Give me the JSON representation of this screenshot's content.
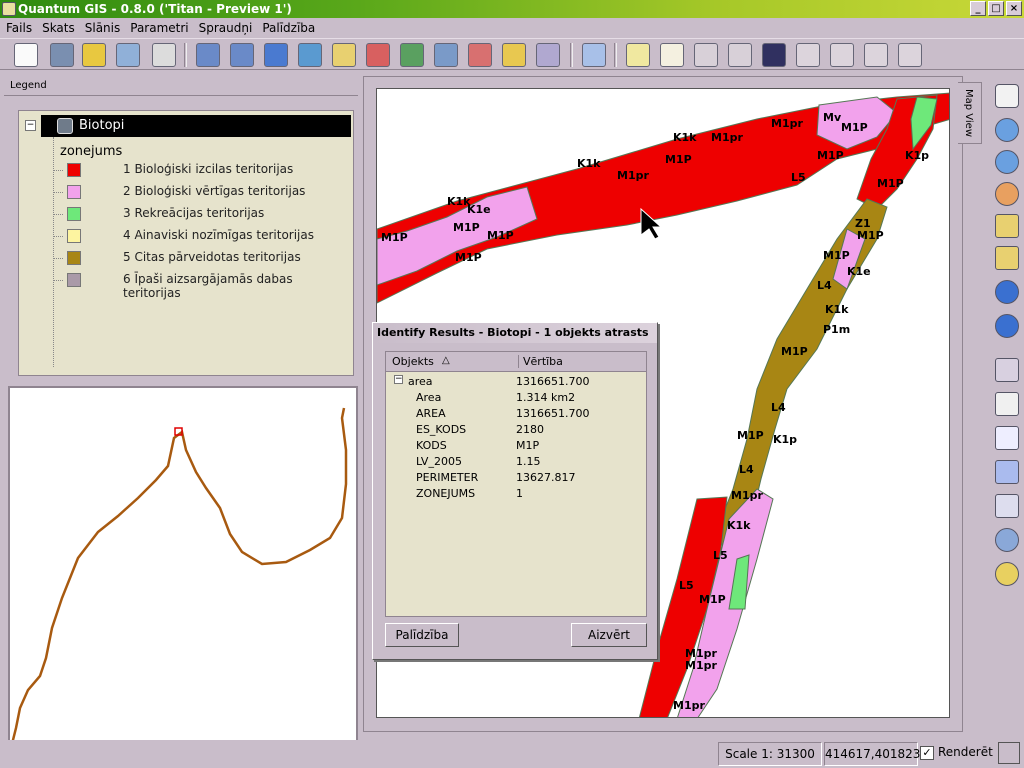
{
  "window": {
    "title": "Quantum GIS - 0.8.0 ('Titan - Preview 1')",
    "min": "_",
    "max": "□",
    "close": "×"
  },
  "menu": [
    "Fails",
    "Skats",
    "Slānis",
    "Parametri",
    "Spraudņi",
    "Palīdzība"
  ],
  "legend": {
    "header": "Legend",
    "layer": "Biotopi",
    "toggle": "−",
    "field": "zonejums",
    "classes": [
      {
        "label": "1 Bioloģiski izcilas teritorijas",
        "color": "#ee0000"
      },
      {
        "label": "2 Bioloģiski vērtīgas teritorijas",
        "color": "#f2a2ec"
      },
      {
        "label": "3 Rekreācijas teritorijas",
        "color": "#6ee87a"
      },
      {
        "label": "4 Ainaviski nozīmīgas teritorijas",
        "color": "#fdf4a0"
      },
      {
        "label": "5 Citas pārveidotas teritorijas",
        "color": "#a88614"
      },
      {
        "label": "6 Īpaši aizsargājamās dabas teritorijas",
        "color": "#aa9aa8"
      }
    ]
  },
  "mapview_tab": "Map View",
  "identify": {
    "title": "Identify Results - Biotopi - 1 objekts atrasts",
    "col_object": "Objekts",
    "col_value": "Vērtība",
    "sort_indicator": "△",
    "root": {
      "name": "area",
      "value": "1316651.700"
    },
    "rows": [
      {
        "key": "Area",
        "value": "1.314 km2"
      },
      {
        "key": "AREA",
        "value": "1316651.700"
      },
      {
        "key": "ES_KODS",
        "value": "2180"
      },
      {
        "key": "KODS",
        "value": "M1P"
      },
      {
        "key": "LV_2005",
        "value": "1.15"
      },
      {
        "key": "PERIMETER",
        "value": "13627.817"
      },
      {
        "key": "ZONEJUMS",
        "value": "1"
      }
    ],
    "help_button": "Palīdzība",
    "close_button": "Aizvērt"
  },
  "map_labels": [
    "M1P",
    "M1pr",
    "K1k",
    "K1p",
    "K1e",
    "L5",
    "L4",
    "Mv",
    "Z1",
    "P1m"
  ],
  "status": {
    "scale": "Scale 1: 31300",
    "coords": "414617,401823",
    "render": "Renderēt"
  }
}
